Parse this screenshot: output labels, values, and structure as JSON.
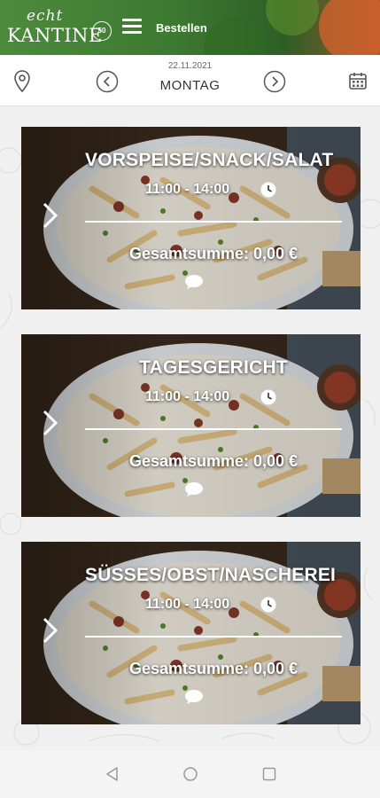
{
  "header": {
    "logo_script": "echt",
    "logo_main": "KANTINE",
    "logo_badge": "50",
    "title": "Bestellen"
  },
  "date_bar": {
    "date": "22.11.2021",
    "weekday": "MONTAG",
    "icons": [
      "location-pin-icon",
      "chevron-left-icon",
      "chevron-right-icon",
      "calendar-icon"
    ]
  },
  "cards": [
    {
      "title": "VORSPEISE/SNACK/SALAT",
      "time": "11:00 - 14:00",
      "total": "Gesamtsumme: 0,00 €"
    },
    {
      "title": "TAGESGERICHT",
      "time": "11:00 - 14:00",
      "total": "Gesamtsumme: 0,00 €"
    },
    {
      "title": "SÜSSES/OBST/NASCHEREI",
      "time": "11:00 - 14:00",
      "total": "Gesamtsumme: 0,00 €"
    }
  ],
  "colors": {
    "header_green": "#3d7a31",
    "card_text": "#ffffff",
    "background": "#f0f0f0"
  },
  "system_nav": [
    "back-icon",
    "home-icon",
    "recents-icon"
  ]
}
